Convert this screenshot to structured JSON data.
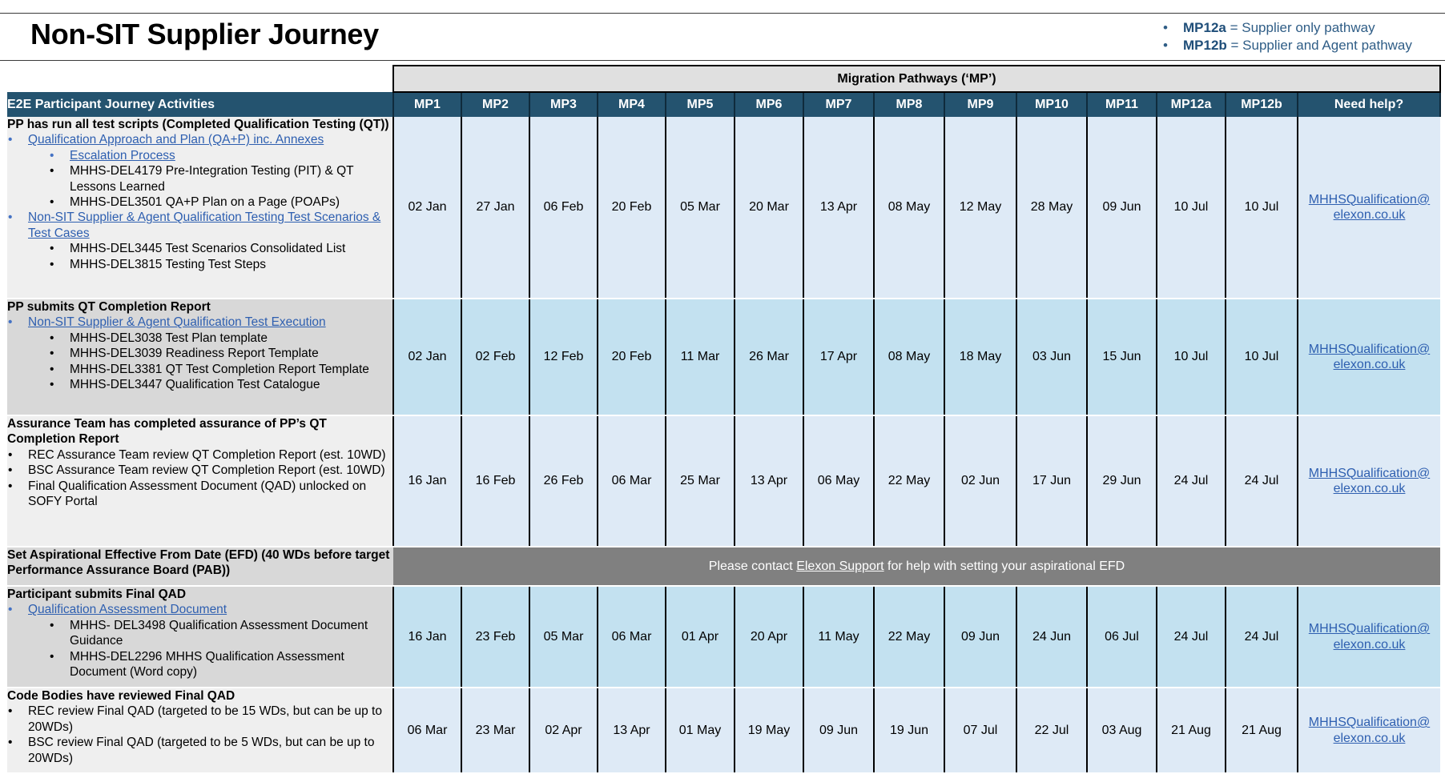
{
  "header": {
    "title": "Non-SIT Supplier Journey",
    "legend": [
      {
        "bullet": "•",
        "code": "MP12a",
        "text": " = Supplier only pathway"
      },
      {
        "bullet": "•",
        "code": "MP12b",
        "text": " = Supplier and Agent pathway"
      }
    ]
  },
  "table": {
    "group_header": "Migration Pathways (‘MP’)",
    "activity_header": "E2E Participant Journey Activities",
    "columns": [
      "MP1",
      "MP2",
      "MP3",
      "MP4",
      "MP5",
      "MP6",
      "MP7",
      "MP8",
      "MP9",
      "MP10",
      "MP11",
      "MP12a",
      "MP12b",
      "Need help?"
    ],
    "help_email_line1": "MHHSQualification@",
    "help_email_line2": "elexon.co.uk",
    "rows": [
      {
        "heading": "PP has run all test scripts (Completed Qualification Testing (QT))",
        "items": [
          {
            "text": "Qualification Approach and Plan (QA+P) inc. Annexes"
          },
          {
            "text": "Escalation Process"
          },
          {
            "text": "MHHS-DEL4179 Pre-Integration Testing (PIT) & QT Lessons Learned"
          },
          {
            "text": "MHHS-DEL3501 QA+P Plan on a Page (POAPs)"
          },
          {
            "text": "Non-SIT Supplier & Agent Qualification Testing Test Scenarios & Test Cases"
          },
          {
            "text": "MHHS-DEL3445 Test Scenarios Consolidated List"
          },
          {
            "text": "MHHS-DEL3815 Testing Test Steps"
          }
        ],
        "dates": [
          "02 Jan",
          "27 Jan",
          "06 Feb",
          "20 Feb",
          "05 Mar",
          "20 Mar",
          "13 Apr",
          "08 May",
          "12 May",
          "28 May",
          "09 Jun",
          "10 Jul",
          "10 Jul"
        ]
      },
      {
        "heading": "PP submits QT Completion Report",
        "items": [
          {
            "text": "Non-SIT Supplier & Agent Qualification Test Execution"
          },
          {
            "text": "MHHS-DEL3038 Test Plan template"
          },
          {
            "text": "MHHS-DEL3039 Readiness Report Template"
          },
          {
            "text": "MHHS-DEL3381 QT Test Completion Report Template"
          },
          {
            "text": "MHHS-DEL3447 Qualification Test Catalogue"
          }
        ],
        "dates": [
          "02 Jan",
          "02 Feb",
          "12 Feb",
          "20 Feb",
          "11 Mar",
          "26 Mar",
          "17 Apr",
          "08 May",
          "18 May",
          "03 Jun",
          "15 Jun",
          "10 Jul",
          "10 Jul"
        ]
      },
      {
        "heading": "Assurance Team has completed assurance of PP’s QT Completion Report",
        "items": [
          {
            "text": "REC Assurance Team review QT Completion Report (est. 10WD)"
          },
          {
            "text": "BSC Assurance Team review QT Completion Report (est. 10WD)"
          },
          {
            "text": "Final Qualification Assessment Document (QAD) unlocked on SOFY Portal"
          }
        ],
        "dates": [
          "16 Jan",
          "16 Feb",
          "26 Feb",
          "06 Mar",
          "25 Mar",
          "13 Apr",
          "06 May",
          "22 May",
          "02 Jun",
          "17 Jun",
          "29 Jun",
          "24 Jul",
          "24 Jul"
        ]
      },
      {
        "heading": "Set Aspirational Effective From Date (EFD) (40 WDs before target Performance Assurance Board (PAB))",
        "note_before": "Please contact ",
        "note_link": "Elexon Support",
        "note_after": " for help with setting your aspirational EFD"
      },
      {
        "heading": "Participant submits Final QAD",
        "items": [
          {
            "text": "Qualification Assessment Document"
          },
          {
            "text": "MHHS- DEL3498 Qualification Assessment Document Guidance"
          },
          {
            "text": "MHHS-DEL2296 MHHS Qualification Assessment Document (Word copy)"
          }
        ],
        "dates": [
          "16 Jan",
          "23 Feb",
          "05 Mar",
          "06 Mar",
          "01 Apr",
          "20 Apr",
          "11 May",
          "22 May",
          "09 Jun",
          "24 Jun",
          "06 Jul",
          "24 Jul",
          "24 Jul"
        ]
      },
      {
        "heading": "Code Bodies have reviewed Final QAD",
        "items": [
          {
            "text": "REC review Final QAD (targeted to be 15 WDs, but can be up to 20WDs)"
          },
          {
            "text": "BSC review Final QAD (targeted to be 5 WDs, but can be up to 20WDs)"
          }
        ],
        "dates": [
          "06 Mar",
          "23 Mar",
          "02 Apr",
          "13 Apr",
          "01 May",
          "19 May",
          "09 Jun",
          "19 Jun",
          "07 Jul",
          "22 Jul",
          "03 Aug",
          "21 Aug",
          "21 Aug"
        ]
      }
    ]
  }
}
